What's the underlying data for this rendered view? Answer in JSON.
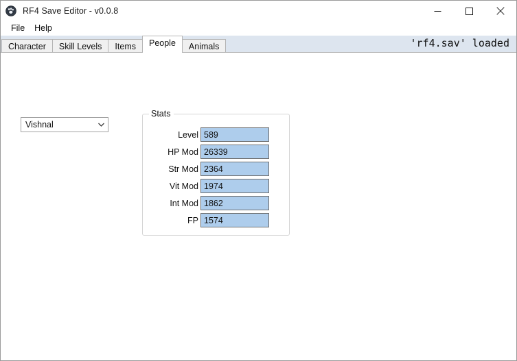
{
  "window": {
    "title": "RF4 Save Editor - v0.0.8",
    "icon": "app-paw-icon",
    "controls": {
      "minimize": "minimize-icon",
      "maximize": "maximize-icon",
      "close": "close-icon"
    }
  },
  "menubar": {
    "items": [
      {
        "label": "File"
      },
      {
        "label": "Help"
      }
    ]
  },
  "tabs": [
    {
      "label": "Character",
      "selected": false
    },
    {
      "label": "Skill Levels",
      "selected": false
    },
    {
      "label": "Items",
      "selected": false
    },
    {
      "label": "People",
      "selected": true
    },
    {
      "label": "Animals",
      "selected": false
    }
  ],
  "status": {
    "text": "'rf4.sav' loaded"
  },
  "character_select": {
    "value": "Vishnal",
    "arrow_icon": "chevron-down-icon"
  },
  "stats_group": {
    "legend": "Stats",
    "fields": [
      {
        "label": "Level",
        "value": "589"
      },
      {
        "label": "HP Mod",
        "value": "26339"
      },
      {
        "label": "Str Mod",
        "value": "2364"
      },
      {
        "label": "Vit Mod",
        "value": "1974"
      },
      {
        "label": "Int Mod",
        "value": "1862"
      },
      {
        "label": "FP",
        "value": "1574"
      }
    ]
  },
  "colors": {
    "tabstrip_bg": "#dde5ef",
    "input_fill": "#aecdec",
    "input_border": "#6e6e6e",
    "window_border": "#9a9a9a",
    "group_border": "#d4d4d4"
  }
}
